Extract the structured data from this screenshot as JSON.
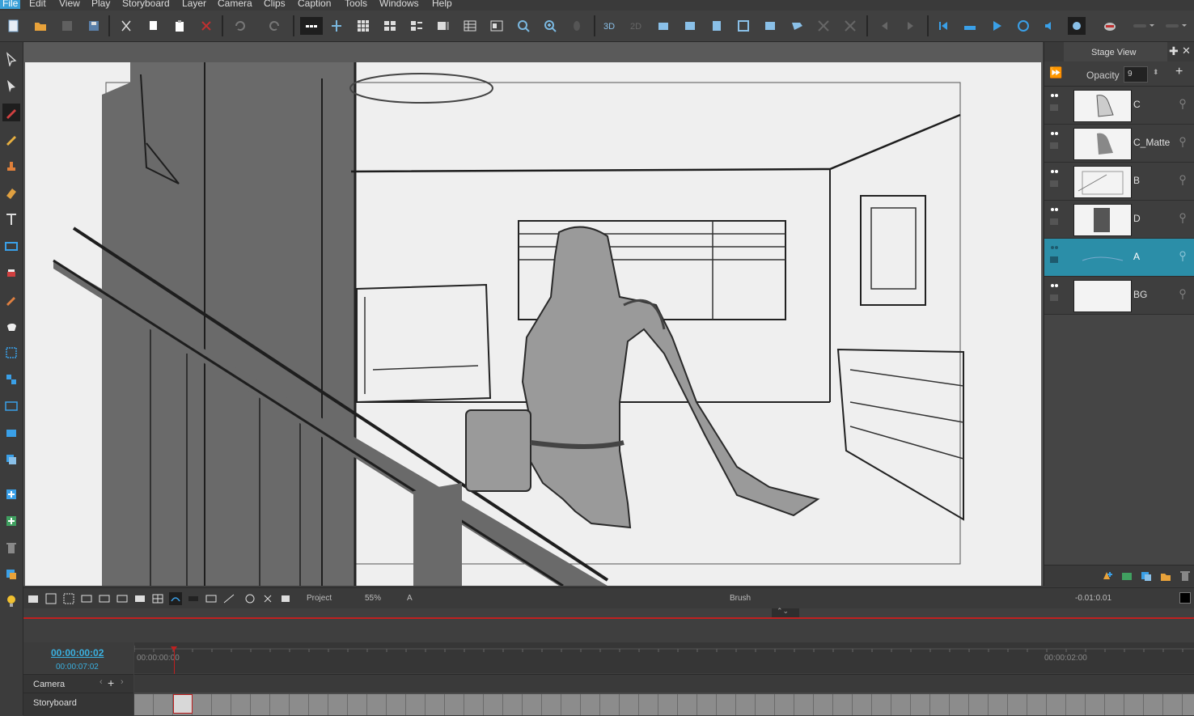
{
  "menu": [
    "File",
    "Edit",
    "View",
    "Play",
    "Storyboard",
    "Layer",
    "Camera",
    "Clips",
    "Caption",
    "Tools",
    "Windows",
    "Help"
  ],
  "stage_panel": {
    "title": "Stage View",
    "opacity_label": "Opacity",
    "opacity_value": "9"
  },
  "layers": [
    {
      "name": "C",
      "selected": false
    },
    {
      "name": "C_Matte",
      "selected": false
    },
    {
      "name": "B",
      "selected": false
    },
    {
      "name": "D",
      "selected": false
    },
    {
      "name": "A",
      "selected": true
    },
    {
      "name": "BG",
      "selected": false
    }
  ],
  "status": {
    "mode": "Project",
    "zoom": "55%",
    "layer": "A",
    "tool": "Brush",
    "timecode": "-0.01:0.01"
  },
  "timeline": {
    "current_time": "00:00:00:02",
    "total_time": "00:00:07:02",
    "ruler_start": "00:00:00:00",
    "ruler_mark": "00:00:02:00",
    "tracks": [
      "Camera",
      "Storyboard"
    ]
  },
  "colors": {
    "accent": "#3aa0d8",
    "selected_layer": "#2b8ea8",
    "playhead": "#c02020",
    "timecode": "#3ab0e0"
  }
}
